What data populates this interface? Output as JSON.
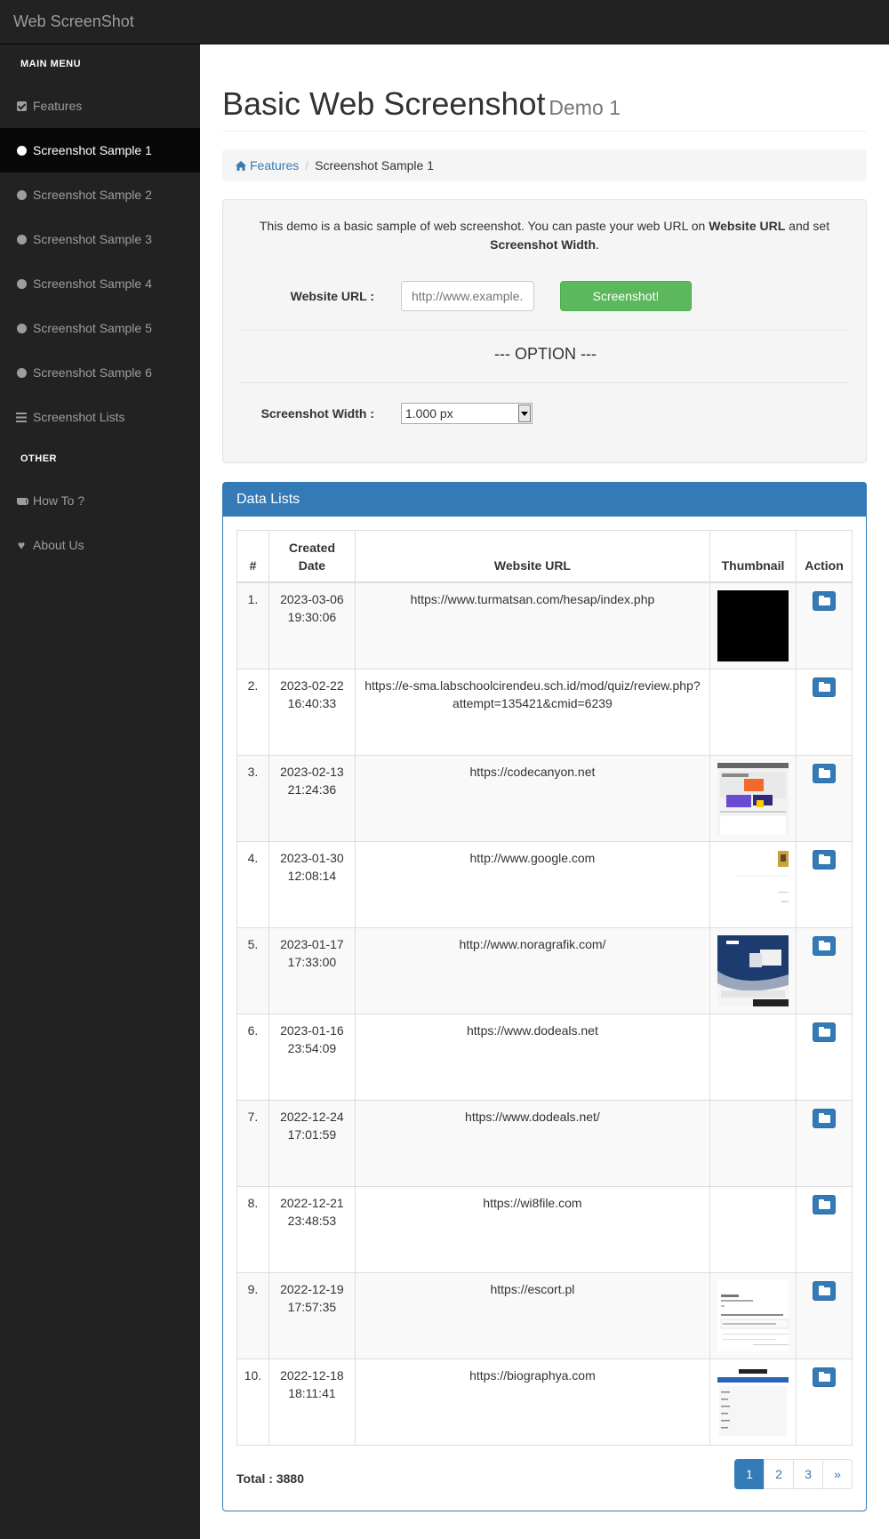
{
  "app": {
    "brand": "Web ScreenShot"
  },
  "sidebar": {
    "main_menu_header": "MAIN MENU",
    "items": [
      {
        "label": "Features",
        "icon": "check-square-icon"
      },
      {
        "label": "Screenshot Sample 1",
        "icon": "circle-icon",
        "active": true
      },
      {
        "label": "Screenshot Sample 2",
        "icon": "circle-icon"
      },
      {
        "label": "Screenshot Sample 3",
        "icon": "circle-icon"
      },
      {
        "label": "Screenshot Sample 4",
        "icon": "circle-icon"
      },
      {
        "label": "Screenshot Sample 5",
        "icon": "circle-icon"
      },
      {
        "label": "Screenshot Sample 6",
        "icon": "circle-icon"
      },
      {
        "label": "Screenshot Lists",
        "icon": "list-icon"
      }
    ],
    "other_header": "OTHER",
    "other_items": [
      {
        "label": "How To ?",
        "icon": "coffee-icon"
      },
      {
        "label": "About Us",
        "icon": "heart-icon"
      }
    ]
  },
  "page": {
    "title": "Basic Web Screenshot",
    "subtitle": "Demo 1"
  },
  "breadcrumb": {
    "home": "Features",
    "current": "Screenshot Sample 1"
  },
  "form": {
    "intro_pre": "This demo is a basic sample of web screenshot. You can paste your web URL on ",
    "intro_b1": "Website URL",
    "intro_mid": " and set ",
    "intro_b2": "Screenshot Width",
    "intro_post": ".",
    "url_label": "Website URL :",
    "url_placeholder": "http://www.example.com",
    "submit_label": "Screenshot!",
    "option_title": "--- OPTION ---",
    "width_label": "Screenshot Width :",
    "width_value": "1.000 px"
  },
  "panel": {
    "title": "Data Lists"
  },
  "table": {
    "headers": {
      "num": "#",
      "date": "Created Date",
      "url": "Website URL",
      "thumb": "Thumbnail",
      "action": "Action"
    },
    "rows": [
      {
        "num": "1.",
        "date": "2023-03-06 19:30:06",
        "url": "https://www.turmatsan.com/hesap/index.php",
        "thumb": "black"
      },
      {
        "num": "2.",
        "date": "2023-02-22 16:40:33",
        "url": "https://e-sma.labschoolcirendeu.sch.id/mod/quiz/review.php?attempt=135421&cmid=6239",
        "thumb": "none"
      },
      {
        "num": "3.",
        "date": "2023-02-13 21:24:36",
        "url": "https://codecanyon.net",
        "thumb": "codecanyon"
      },
      {
        "num": "4.",
        "date": "2023-01-30 12:08:14",
        "url": "http://www.google.com",
        "thumb": "google"
      },
      {
        "num": "5.",
        "date": "2023-01-17 17:33:00",
        "url": "http://www.noragrafik.com/",
        "thumb": "noragrafik"
      },
      {
        "num": "6.",
        "date": "2023-01-16 23:54:09",
        "url": "https://www.dodeals.net",
        "thumb": "none"
      },
      {
        "num": "7.",
        "date": "2022-12-24 17:01:59",
        "url": "https://www.dodeals.net/",
        "thumb": "none"
      },
      {
        "num": "8.",
        "date": "2022-12-21 23:48:53",
        "url": "https://wi8file.com",
        "thumb": "none"
      },
      {
        "num": "9.",
        "date": "2022-12-19 17:57:35",
        "url": "https://escort.pl",
        "thumb": "escort"
      },
      {
        "num": "10.",
        "date": "2022-12-18 18:11:41",
        "url": "https://biographya.com",
        "thumb": "biographya"
      }
    ]
  },
  "footer": {
    "total": "Total : 3880",
    "pages": [
      "1",
      "2",
      "3",
      "»"
    ],
    "active_page": "1"
  },
  "colors": {
    "primary": "#337ab7",
    "success": "#5cb85c",
    "nav": "#222222"
  }
}
